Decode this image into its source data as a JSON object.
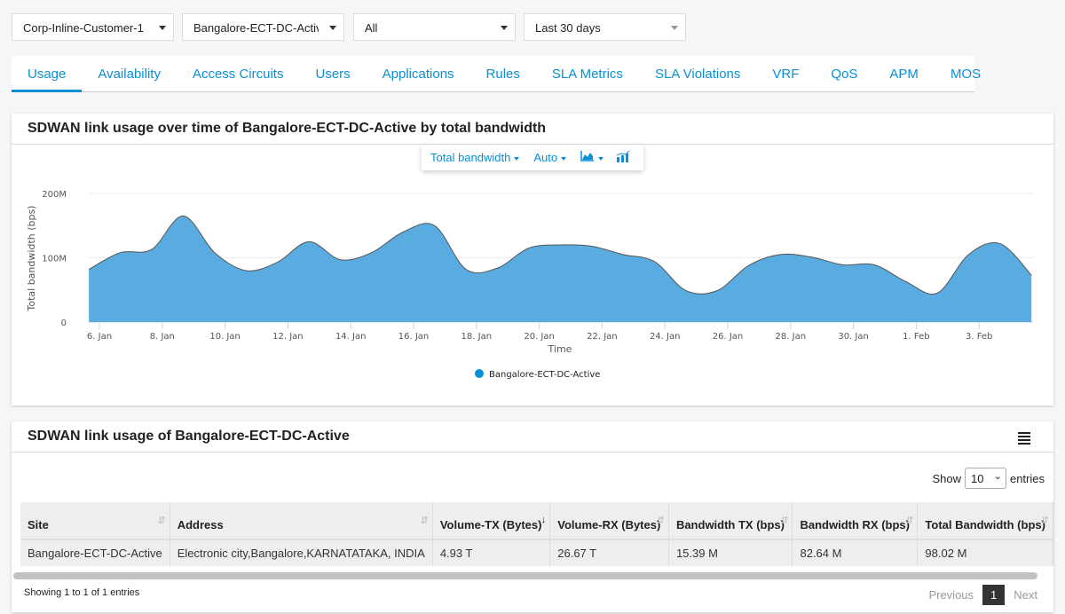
{
  "filters": {
    "customer": "Corp-Inline-Customer-1",
    "site": "Bangalore-ECT-DC-Active",
    "circuit": "All",
    "range": "Last 30 days"
  },
  "tabs": [
    "Usage",
    "Availability",
    "Access Circuits",
    "Users",
    "Applications",
    "Rules",
    "SLA Metrics",
    "SLA Violations",
    "VRF",
    "QoS",
    "APM",
    "MOS"
  ],
  "chart_panel": {
    "title": "SDWAN link usage over time of Bangalore-ECT-DC-Active by total bandwidth",
    "toolbar": {
      "metric": "Total bandwidth",
      "interval": "Auto",
      "chart_type_icon": "area-chart-icon",
      "extra_icon": "bar-chart-icon"
    }
  },
  "chart_data": {
    "type": "area",
    "xlabel": "Time",
    "ylabel": "Total bandwidth (bps)",
    "ylim": [
      0,
      200000000
    ],
    "grid": true,
    "legend": "bottom-center",
    "y_ticks": [
      "0",
      "100M",
      "200M"
    ],
    "x_ticks": [
      "6. Jan",
      "8. Jan",
      "10. Jan",
      "12. Jan",
      "14. Jan",
      "16. Jan",
      "18. Jan",
      "20. Jan",
      "22. Jan",
      "24. Jan",
      "26. Jan",
      "28. Jan",
      "30. Jan",
      "1. Feb",
      "3. Feb"
    ],
    "series": [
      {
        "name": "Bangalore-ECT-DC-Active",
        "color": "#5aace0",
        "x": [
          "01-05 16:00",
          "01-06 16:00",
          "01-07 16:00",
          "01-08 16:00",
          "01-09 16:00",
          "01-10 16:00",
          "01-11 16:00",
          "01-12 16:00",
          "01-13 16:00",
          "01-14 16:00",
          "01-15 16:00",
          "01-16 16:00",
          "01-17 16:00",
          "01-18 16:00",
          "01-19 16:00",
          "01-20 16:00",
          "01-21 16:00",
          "01-22 16:00",
          "01-23 16:00",
          "01-24 16:00",
          "01-25 16:00",
          "01-26 16:00",
          "01-27 16:00",
          "01-28 16:00",
          "01-29 16:00",
          "01-30 16:00",
          "01-31 16:00",
          "02-01 16:00",
          "02-02 16:00",
          "02-03 16:00",
          "02-04 16:00"
        ],
        "values": [
          82,
          108,
          113,
          165,
          108,
          80,
          93,
          125,
          97,
          108,
          140,
          150,
          82,
          84,
          115,
          120,
          118,
          105,
          94,
          49,
          49,
          88,
          105,
          101,
          89,
          89,
          63,
          45,
          105,
          122,
          73
        ],
        "unit": "M"
      }
    ]
  },
  "table_panel": {
    "title": "SDWAN link usage of Bangalore-ECT-DC-Active",
    "show": "Show",
    "entries_select": "10",
    "entries": "entries",
    "columns": [
      "Site",
      "Address",
      "Volume-TX (Bytes)",
      "Volume-RX (Bytes)",
      "Bandwidth TX (bps)",
      "Bandwidth RX (bps)",
      "Total Bandwidth (bps)"
    ],
    "rows": [
      [
        "Bangalore-ECT-DC-Active",
        "Electronic city,Bangalore,KARNATATAKA, INDIA",
        "4.93 T",
        "26.67 T",
        "15.39 M",
        "82.64 M",
        "98.02 M"
      ]
    ],
    "info": "Showing 1 to 1 of 1 entries",
    "prev": "Previous",
    "page": "1",
    "next": "Next"
  }
}
